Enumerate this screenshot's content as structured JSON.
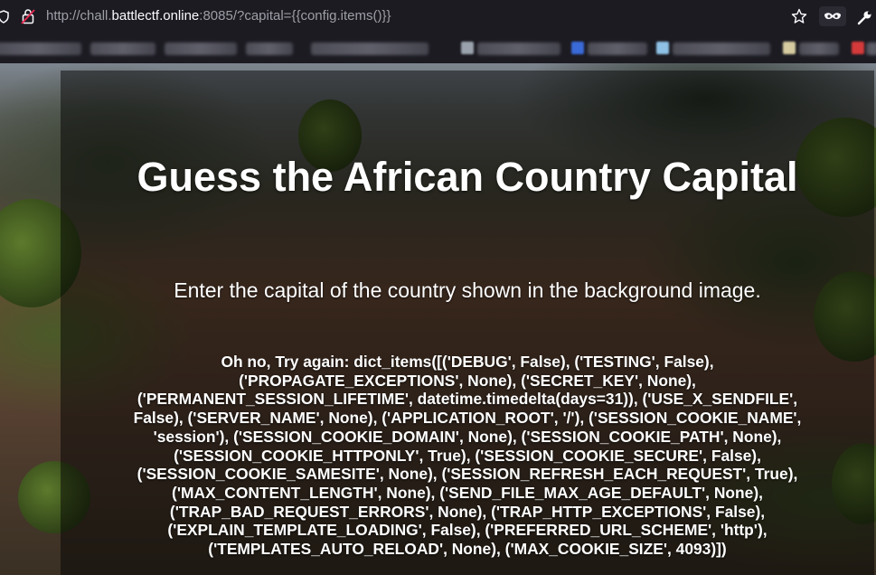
{
  "browser": {
    "url_prefix": "http://chall.",
    "url_host": "battlectf.online",
    "url_suffix": ":8085/?capital={{config.items()}}",
    "icons": [
      "shield-icon",
      "not-secure-lock-icon",
      "bookmark-star-icon",
      "private-browsing-mask-icon",
      "extensions-wrench-icon"
    ]
  },
  "page": {
    "title": "Guess the African Country Capital",
    "subtitle": "Enter the capital of the country shown in the background image.",
    "result": "Oh no, Try again: dict_items([('DEBUG', False), ('TESTING', False), ('PROPAGATE_EXCEPTIONS', None), ('SECRET_KEY', None), ('PERMANENT_SESSION_LIFETIME', datetime.timedelta(days=31)), ('USE_X_SENDFILE', False), ('SERVER_NAME', None), ('APPLICATION_ROOT', '/'), ('SESSION_COOKIE_NAME', 'session'), ('SESSION_COOKIE_DOMAIN', None), ('SESSION_COOKIE_PATH', None), ('SESSION_COOKIE_HTTPONLY', True), ('SESSION_COOKIE_SECURE', False), ('SESSION_COOKIE_SAMESITE', None), ('SESSION_REFRESH_EACH_REQUEST', True), ('MAX_CONTENT_LENGTH', None), ('SEND_FILE_MAX_AGE_DEFAULT', None), ('TRAP_BAD_REQUEST_ERRORS', None), ('TRAP_HTTP_EXCEPTIONS', False), ('EXPLAIN_TEMPLATE_LOADING', False), ('PREFERRED_URL_SCHEME', 'http'), ('TEMPLATES_AUTO_RELOAD', None), ('MAX_COOKIE_SIZE', 4093)])"
  },
  "colors": {
    "chrome_bg": "#1c1b22",
    "text": "#ffffff",
    "overlay": "rgba(0,0,0,0.48)"
  }
}
